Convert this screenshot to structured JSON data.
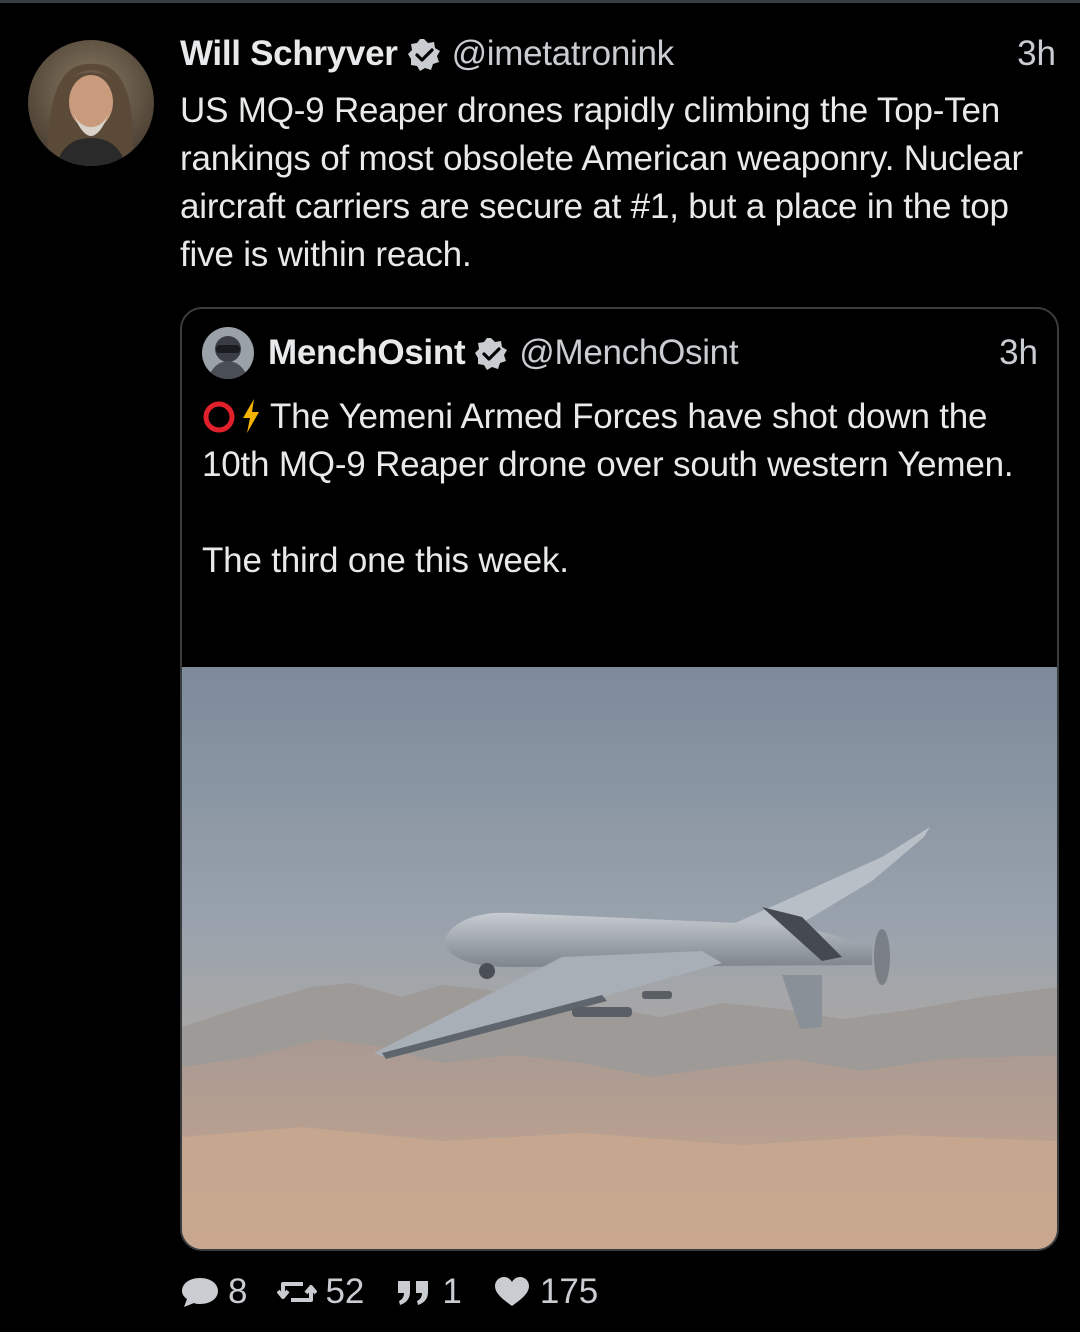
{
  "tweet": {
    "author_name": "Will Schryver",
    "handle": "@imetatronink",
    "timestamp": "3h",
    "text": "US MQ-9 Reaper drones rapidly climbing the Top-Ten rankings of most obsolete American weaponry. Nuclear aircraft carriers are secure at #1, but a place in the top five is within reach.",
    "avatar_icon": "person-avatar",
    "verified_icon": "verified-badge-icon"
  },
  "quoted_tweet": {
    "author_name": "MenchOsint",
    "handle": "@MenchOsint",
    "timestamp": "3h",
    "emoji": [
      "red-circle-emoji",
      "lightning-emoji"
    ],
    "text_line1": "The Yemeni Armed Forces have shot down the 10th MQ-9 Reaper drone over south western Yemen.",
    "text_line2": "The third one this week.",
    "media": "photo-mq9-reaper-drone-over-desert"
  },
  "actions": {
    "replies": "8",
    "retweets": "52",
    "quotes": "1",
    "likes": "175",
    "icons": [
      "reply-icon",
      "retweet-icon",
      "quote-icon",
      "like-icon"
    ]
  },
  "colors": {
    "background": "#000000",
    "text": "#e7e9ea",
    "secondary_text": "#c9ccd0",
    "border": "#3a3d40",
    "verified_badge": "#c9ccd0"
  }
}
